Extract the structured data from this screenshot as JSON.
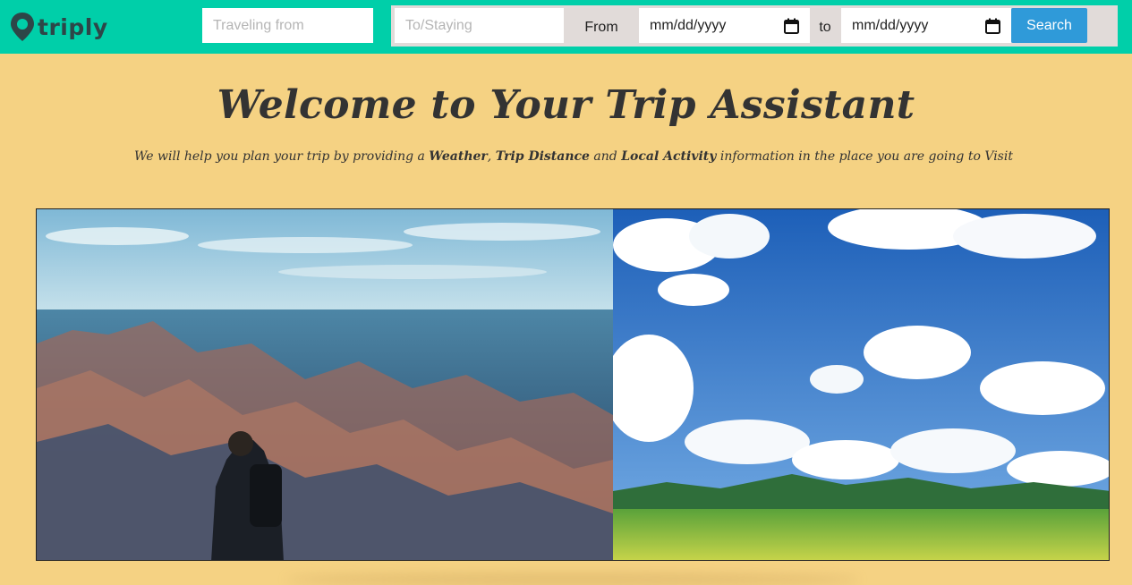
{
  "app": {
    "brand": "triply",
    "brand_color": "#00cfa9",
    "background": "#f5d283"
  },
  "header": {
    "traveling_from_placeholder": "Traveling from",
    "to_staying_placeholder": "To/Staying",
    "from_label": "From",
    "to_label": "to",
    "start_date_value": "mm/dd/yyyy",
    "end_date_value": "mm/dd/yyyy",
    "search_label": "Search",
    "search_color": "#2f9ad9"
  },
  "hero": {
    "title": "Welcome to Your Trip Assistant",
    "subtitle_1": "We will help you plan your trip by providing a ",
    "highlight_weather": "Weather",
    "sep_1": ", ",
    "highlight_distance": "Trip Distance",
    "sep_2": " and ",
    "highlight_activity": "Local Activity",
    "subtitle_2": " information in the place you are going to Visit"
  },
  "images": {
    "left": "canyon-hiker-photo",
    "right": "green-meadow-blue-sky-photo"
  }
}
